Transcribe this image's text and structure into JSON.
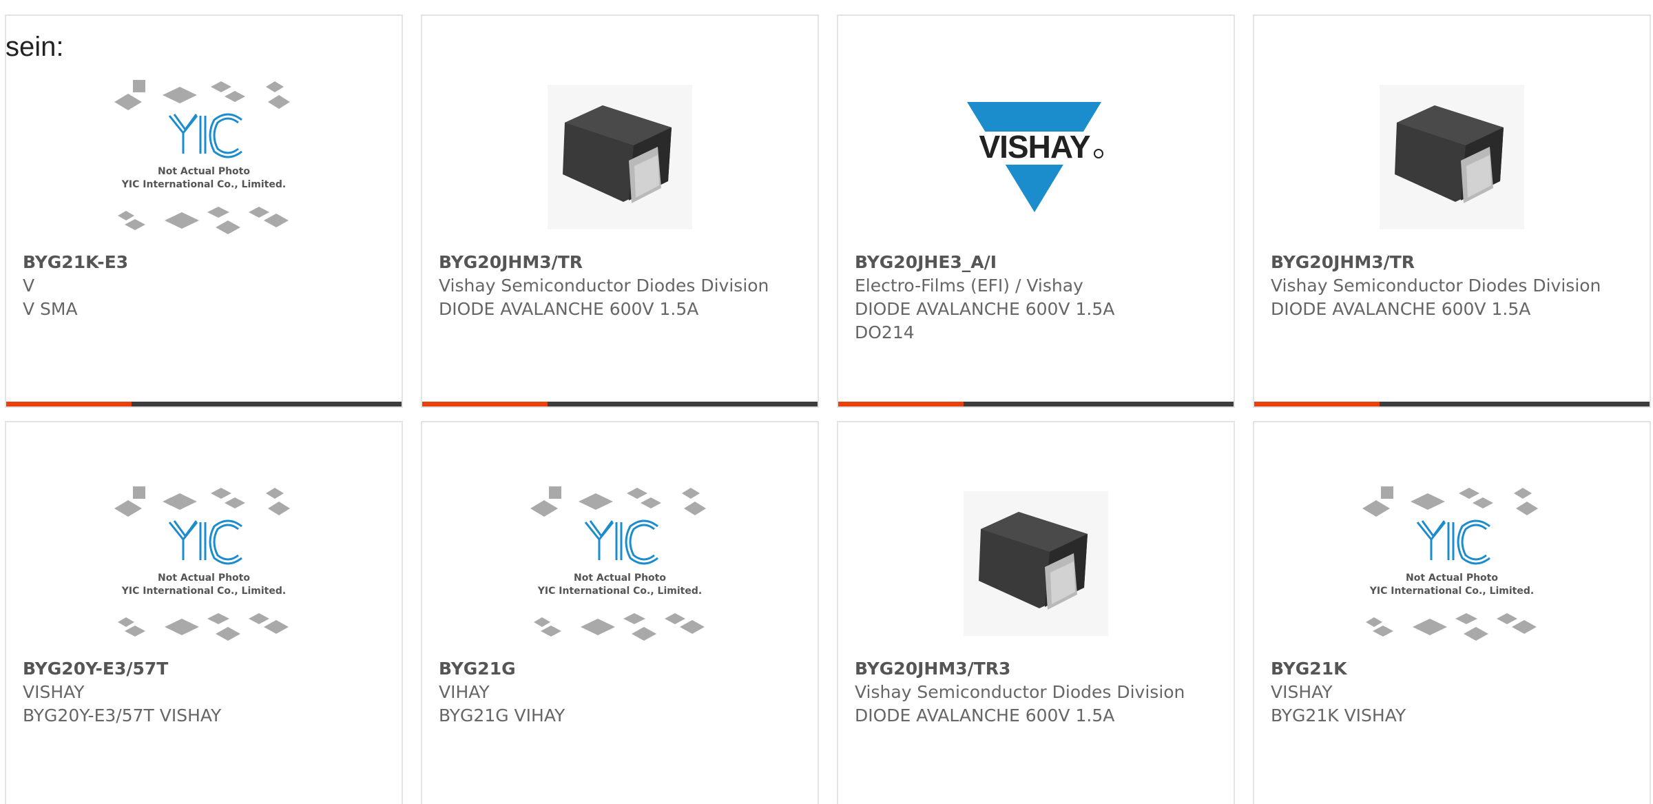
{
  "stray_text": "sein:",
  "colors": {
    "accent": "#e8410b",
    "bar": "#3d3d3d",
    "vishay_blue": "#1b8ccc"
  },
  "placeholder": {
    "brand": "YIC",
    "line1": "Not Actual Photo",
    "line2": "YIC International Co., Limited."
  },
  "vishay_logo_text": "VISHAY",
  "products": [
    {
      "part": "BYG21K-E3",
      "lines": [
        "V",
        "V SMA"
      ],
      "image": "yic-placeholder"
    },
    {
      "part": "BYG20JHM3/TR",
      "lines": [
        "Vishay Semiconductor Diodes Division",
        "DIODE AVALANCHE 600V 1.5A"
      ],
      "image": "diode-smd-package"
    },
    {
      "part": "BYG20JHE3_A/I",
      "lines": [
        "Electro-Films (EFI) / Vishay",
        "DIODE AVALANCHE 600V 1.5A",
        "DO214"
      ],
      "image": "vishay-logo"
    },
    {
      "part": "BYG20JHM3/TR",
      "lines": [
        "Vishay Semiconductor Diodes Division",
        "DIODE AVALANCHE 600V 1.5A"
      ],
      "image": "diode-smd-package"
    },
    {
      "part": "BYG20Y-E3/57T",
      "lines": [
        "VISHAY",
        "BYG20Y-E3/57T VISHAY"
      ],
      "image": "yic-placeholder"
    },
    {
      "part": "BYG21G",
      "lines": [
        "VIHAY",
        "BYG21G VIHAY"
      ],
      "image": "yic-placeholder"
    },
    {
      "part": "BYG20JHM3/TR3",
      "lines": [
        "Vishay Semiconductor Diodes Division",
        "DIODE AVALANCHE 600V 1.5A"
      ],
      "image": "diode-smd-package"
    },
    {
      "part": "BYG21K",
      "lines": [
        "VISHAY",
        "BYG21K VISHAY"
      ],
      "image": "yic-placeholder"
    }
  ]
}
